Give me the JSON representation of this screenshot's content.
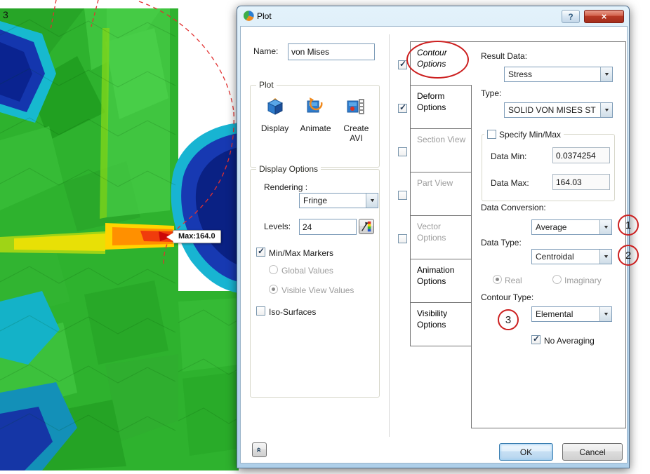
{
  "colors": {
    "titlebar_blue": "#bcd8ee",
    "close_red": "#b83a25",
    "annotation_red": "#cc1f1f",
    "fringe_green": "#2eb22e",
    "fringe_blue": "#12309f",
    "hot_red": "#d80f0f"
  },
  "icons": {
    "close": "×",
    "help": "?",
    "dropdown": "▼",
    "check": "✓",
    "collapse": "«",
    "app": "plot-icon",
    "display": "display-plot-icon",
    "animate": "animate-plot-icon",
    "create_avi": "create-avi-icon",
    "levels": "contour-levels-icon"
  },
  "background": {
    "corner_label": "3",
    "max_marker": "Max:164.0"
  },
  "dialog": {
    "title": "Plot",
    "name": {
      "label": "Name:",
      "value": "von Mises"
    },
    "plot_group": {
      "label": "Plot",
      "tools": [
        {
          "label": "Display"
        },
        {
          "label": "Animate"
        },
        {
          "label": "Create AVI"
        }
      ]
    },
    "display_options": {
      "label": "Display Options",
      "rendering_label": "Rendering :",
      "rendering_value": "Fringe",
      "levels_label": "Levels:",
      "levels_value": "24",
      "minmax_label": "Min/Max Markers",
      "global_label": "Global Values",
      "visible_label": "Visible View Values",
      "iso_label": "Iso-Surfaces"
    },
    "tabs": [
      {
        "label": "Contour Options"
      },
      {
        "label": "Deform Options"
      },
      {
        "label": "Section View"
      },
      {
        "label": "Part View"
      },
      {
        "label": "Vector Options"
      },
      {
        "label": "Animation Options"
      },
      {
        "label": "Visibility Options"
      }
    ],
    "contour": {
      "result_label": "Result Data:",
      "result_value": "Stress",
      "type_label": "Type:",
      "type_value": "SOLID VON MISES ST",
      "specify_label": "Specify Min/Max",
      "min_label": "Data Min:",
      "min_value": "0.0374254",
      "max_label": "Data Max:",
      "max_value": "164.03",
      "conversion_label": "Data Conversion:",
      "conversion_value": "Average",
      "datatype_label": "Data Type:",
      "datatype_value": "Centroidal",
      "real_label": "Real",
      "imaginary_label": "Imaginary",
      "contourtype_label": "Contour Type:",
      "contourtype_value": "Elemental",
      "noavg_label": "No Averaging"
    },
    "footer": {
      "ok": "OK",
      "cancel": "Cancel"
    }
  },
  "annotations": {
    "one": "1",
    "two": "2",
    "three": "3"
  }
}
